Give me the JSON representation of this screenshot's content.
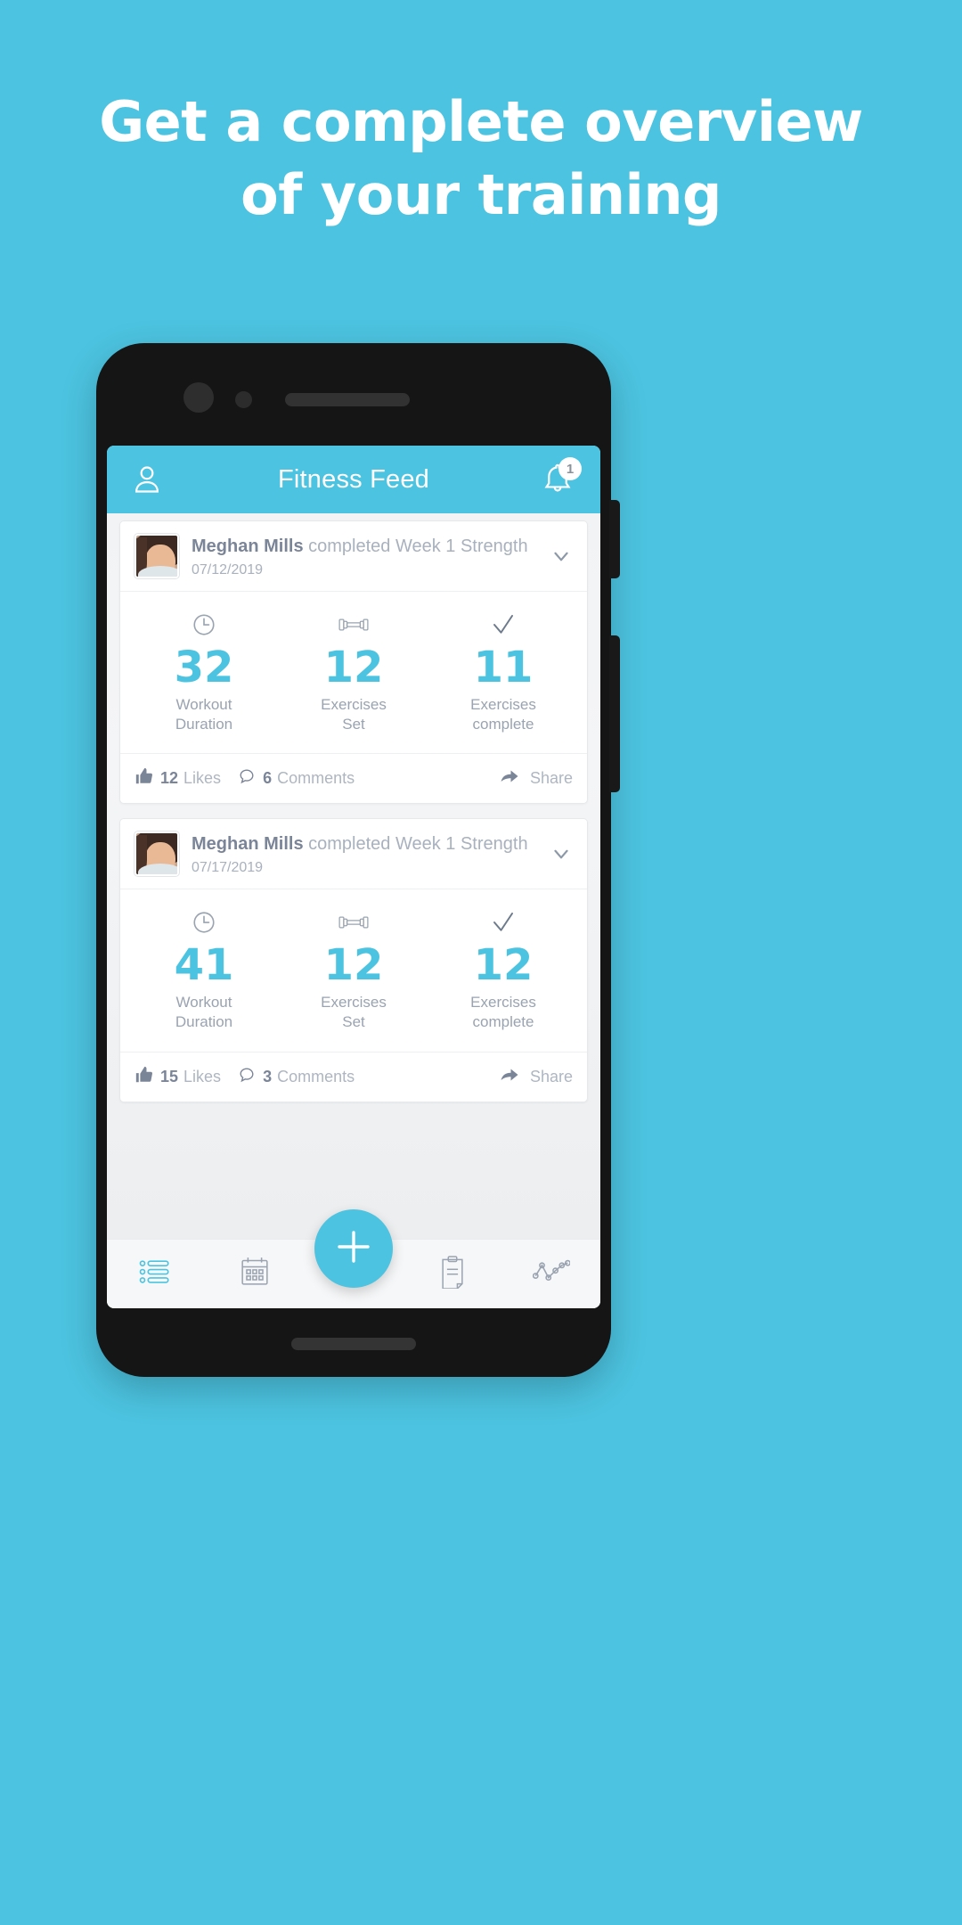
{
  "headline": "Get a complete overview of your training",
  "theme": {
    "accent": "#4cc3e0",
    "text_muted": "#a8b1bd",
    "text_dark": "#7b8598"
  },
  "appbar": {
    "title": "Fitness Feed",
    "profile_icon": "person-icon",
    "bell_icon": "bell-icon",
    "notification_count": "1"
  },
  "feed": {
    "posts": [
      {
        "user": "Meghan Mills",
        "action": "completed Week 1 Strength",
        "date": "07/12/2019",
        "expand_icon": "chevron-down-icon",
        "stats": [
          {
            "icon": "clock-icon",
            "value": "32",
            "label_line1": "Workout",
            "label_line2": "Duration"
          },
          {
            "icon": "dumbbell-icon",
            "value": "12",
            "label_line1": "Exercises",
            "label_line2": "Set"
          },
          {
            "icon": "check-icon",
            "value": "11",
            "label_line1": "Exercises",
            "label_line2": "complete"
          }
        ],
        "likes_count": "12",
        "likes_label": "Likes",
        "comments_count": "6",
        "comments_label": "Comments",
        "share_label": "Share"
      },
      {
        "user": "Meghan Mills",
        "action": "completed Week 1 Strength",
        "date": "07/17/2019",
        "expand_icon": "chevron-down-icon",
        "stats": [
          {
            "icon": "clock-icon",
            "value": "41",
            "label_line1": "Workout",
            "label_line2": "Duration"
          },
          {
            "icon": "dumbbell-icon",
            "value": "12",
            "label_line1": "Exercises",
            "label_line2": "Set"
          },
          {
            "icon": "check-icon",
            "value": "12",
            "label_line1": "Exercises",
            "label_line2": "complete"
          }
        ],
        "likes_count": "15",
        "likes_label": "Likes",
        "comments_count": "3",
        "comments_label": "Comments",
        "share_label": "Share"
      }
    ]
  },
  "navbar": {
    "items": [
      {
        "icon": "feed-list-icon",
        "active": true
      },
      {
        "icon": "calendar-icon",
        "active": false
      },
      {
        "icon": "clipboard-icon",
        "active": false
      },
      {
        "icon": "chart-line-icon",
        "active": false
      }
    ],
    "fab_icon": "plus-icon"
  }
}
